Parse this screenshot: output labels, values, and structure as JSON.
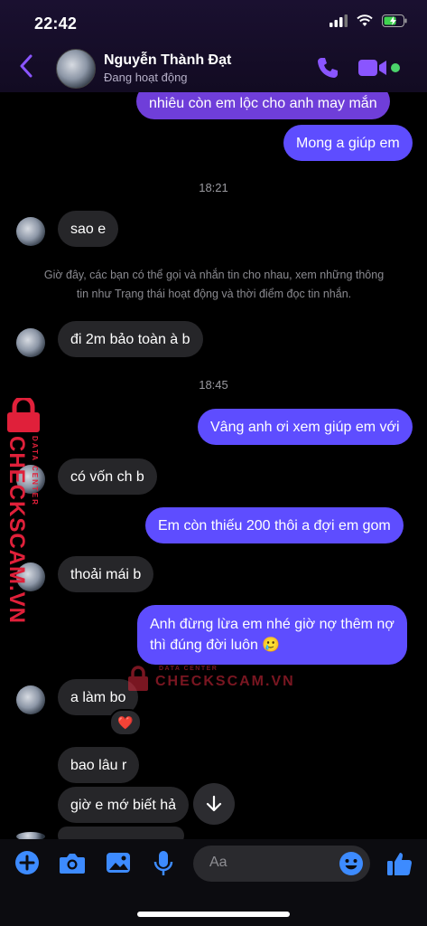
{
  "status_bar": {
    "time": "22:42"
  },
  "header": {
    "contact_name": "Nguyễn Thành Đạt",
    "contact_status": "Đang hoạt động"
  },
  "messages": {
    "m1": "nhiêu còn em lộc cho anh may mắn",
    "m2": "Mong a giúp em",
    "t1": "18:21",
    "m3": "sao e",
    "notice_line1": "Giờ đây, các bạn có thể gọi và nhắn tin cho nhau, xem những thông",
    "notice_line2": "tin như Trạng thái hoạt động và thời điểm đọc tin nhắn.",
    "m4": "đi 2m bảo toàn à b",
    "t2": "18:45",
    "m5": "Vâng anh ơi xem giúp em với",
    "m6": "có vốn ch b",
    "m7": "Em còn thiếu 200 thôi a đợi em gom",
    "m8": "thoải mái b",
    "m9_line1": "Anh đừng lừa em nhé giờ nợ thêm nợ",
    "m9_line2": "thì đúng đời luôn 🥲",
    "m10": "a làm bo",
    "m11": "bao lâu r",
    "m12": "giờ e mớ biết hả"
  },
  "reaction": "❤️",
  "watermark": {
    "vertical_top": "DATA CENTER",
    "vertical_main": "CHECKSCAM.VN",
    "inline_small": "DATA CENTER",
    "inline_main": "CHECKSCAM.VN"
  },
  "composer": {
    "placeholder": "Aa"
  },
  "colors": {
    "accent": "#8a55ff",
    "outgoing_bubble": "#5e4dff",
    "incoming_bubble": "#262629",
    "online": "#4bd36b",
    "tool_blue": "#3d8bff"
  }
}
